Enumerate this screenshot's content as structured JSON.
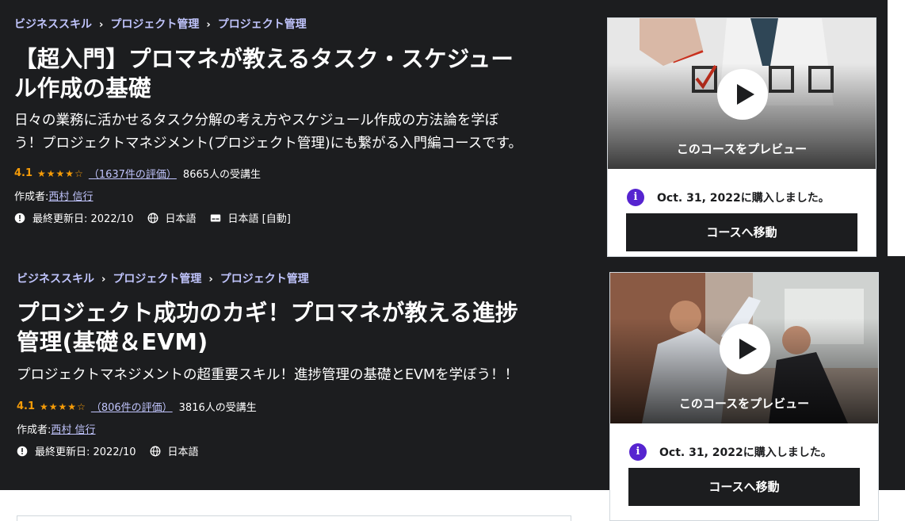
{
  "courses": [
    {
      "breadcrumb": [
        "ビジネススキル",
        "プロジェクト管理",
        "プロジェクト管理"
      ],
      "breadcrumb_sep": "›",
      "title_line1": "【超入門】プロマネが教えるタスク・スケジュー",
      "title_line2": "ル作成の基礎",
      "desc_line1": "日々の業務に活かせるタスク分解の考え方やスケジュール作成の方法論を学ぼ",
      "desc_line2": "う！プロジェクトマネジメント(プロジェクト管理)にも繋がる入門編コースです。",
      "rating": "4.1",
      "stars": "★★★★☆",
      "rating_count": "（1637件の評価）",
      "students": "8665人の受講生",
      "author_label": "作成者:",
      "author": "西村 信行",
      "updated": "最終更新日: 2022/10",
      "language": "日本語",
      "captions": "日本語 [自動]",
      "preview_label": "このコースをプレビュー",
      "purchased": "Oct. 31, 2022に購入しました。",
      "goto_label": "コースへ移動"
    },
    {
      "breadcrumb": [
        "ビジネススキル",
        "プロジェクト管理",
        "プロジェクト管理"
      ],
      "breadcrumb_sep": "›",
      "title_line1": "プロジェクト成功のカギ！プロマネが教える進捗",
      "title_line2": "管理(基礎＆EVM)",
      "desc_line1": "プロジェクトマネジメントの超重要スキル！進捗管理の基礎とEVMを学ぼう！！",
      "rating": "4.1",
      "stars": "★★★★☆",
      "rating_count": "（806件の評価）",
      "students": "3816人の受講生",
      "author_label": "作成者:",
      "author": "西村 信行",
      "updated": "最終更新日: 2022/10",
      "language": "日本語",
      "preview_label": "このコースをプレビュー",
      "purchased": "Oct. 31, 2022に購入しました。",
      "goto_label": "コースへ移動"
    }
  ],
  "icons": {
    "info": "info-icon",
    "update": "alert-badge-icon",
    "language": "globe-icon",
    "captions": "closed-captions-icon",
    "play": "play-icon"
  },
  "colors": {
    "dark_bg": "#1c1d1f",
    "link": "#c0c4fc",
    "star": "#f69c08",
    "accent": "#5624d0"
  }
}
